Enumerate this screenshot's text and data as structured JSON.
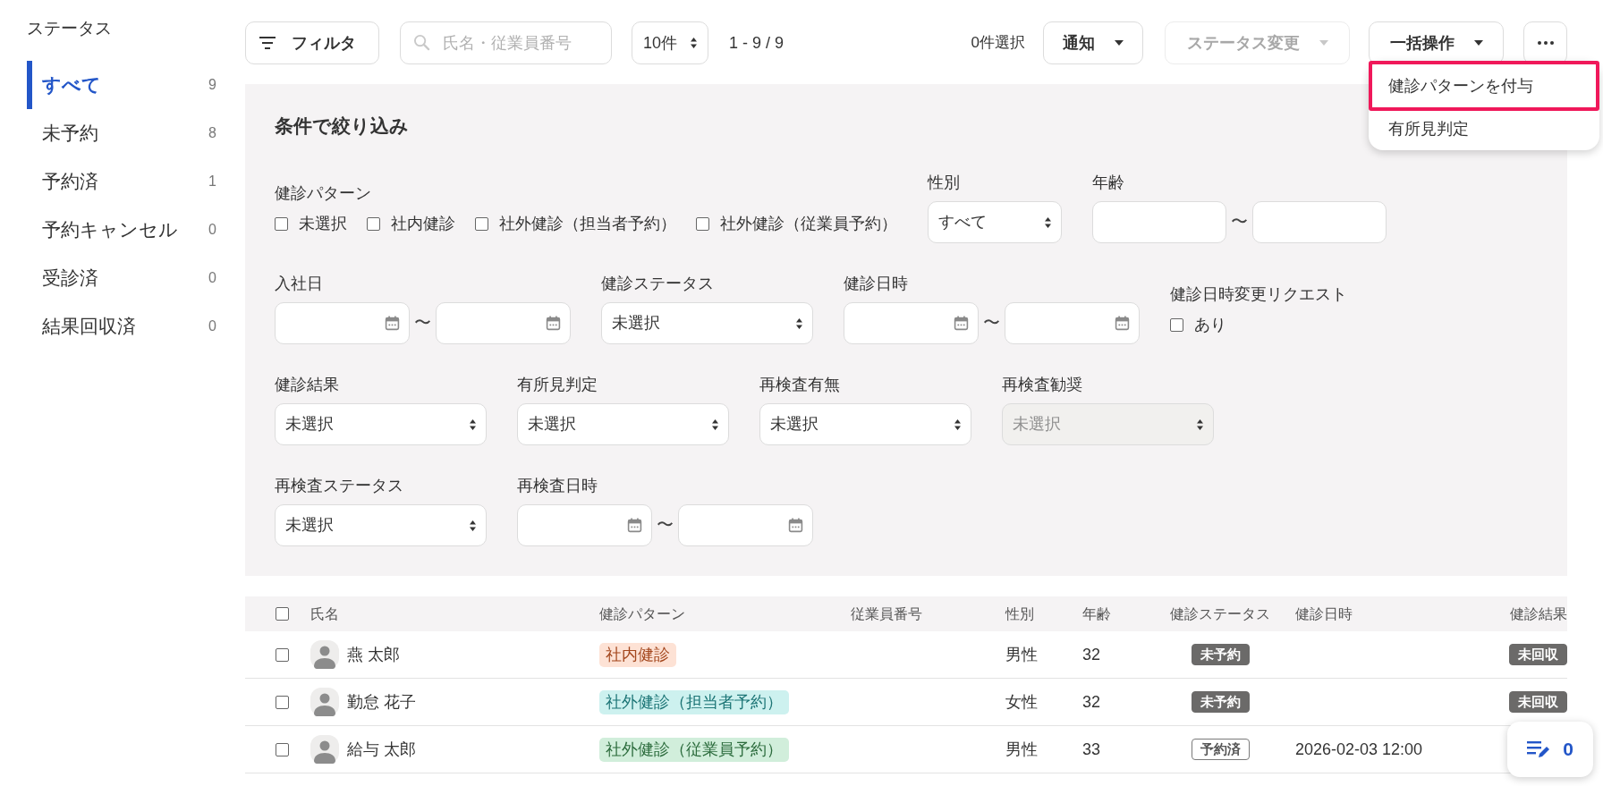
{
  "sidebar": {
    "title": "ステータス",
    "items": [
      {
        "label": "すべて",
        "count": "9",
        "selected": true
      },
      {
        "label": "未予約",
        "count": "8",
        "selected": false
      },
      {
        "label": "予約済",
        "count": "1",
        "selected": false
      },
      {
        "label": "予約キャンセル",
        "count": "0",
        "selected": false
      },
      {
        "label": "受診済",
        "count": "0",
        "selected": false
      },
      {
        "label": "結果回収済",
        "count": "0",
        "selected": false
      }
    ]
  },
  "toolbar": {
    "filter_button": "フィルタ",
    "search": {
      "placeholder": "氏名・従業員番号"
    },
    "page_size": "10件",
    "range": "1 - 9 / 9",
    "selection_count": "0件選択",
    "actions": [
      {
        "label": "通知",
        "disabled": false
      },
      {
        "label": "ステータス変更",
        "disabled": true
      },
      {
        "label": "一括操作",
        "disabled": false,
        "expanded": true,
        "menu": [
          {
            "label": "健診パターンを付与",
            "highlighted": true
          },
          {
            "label": "有所見判定",
            "highlighted": false
          }
        ]
      }
    ]
  },
  "filter_panel": {
    "title": "条件で絞り込み",
    "rows": [
      [
        {
          "kind": "checkboxes",
          "label": "健診パターン",
          "options": [
            {
              "label": "未選択",
              "checked": false
            },
            {
              "label": "社内健診",
              "checked": false
            },
            {
              "label": "社外健診（担当者予約）",
              "checked": false
            },
            {
              "label": "社外健診（従業員予約）",
              "checked": false
            }
          ]
        },
        {
          "kind": "select",
          "label": "性別",
          "value": "すべて",
          "disabled": false
        },
        {
          "kind": "number_range",
          "label": "年齢",
          "separator": "〜"
        }
      ],
      [
        {
          "kind": "date_range",
          "label": "入社日",
          "separator": "〜"
        },
        {
          "kind": "select",
          "label": "健診ステータス",
          "value": "未選択",
          "disabled": false
        },
        {
          "kind": "date_range",
          "label": "健診日時",
          "separator": "〜"
        },
        {
          "kind": "checkboxes",
          "label": "健診日時変更リクエスト",
          "options": [
            {
              "label": "あり",
              "checked": false
            }
          ]
        }
      ],
      [
        {
          "kind": "select",
          "label": "健診結果",
          "value": "未選択",
          "disabled": false
        },
        {
          "kind": "select",
          "label": "有所見判定",
          "value": "未選択",
          "disabled": false
        },
        {
          "kind": "select",
          "label": "再検査有無",
          "value": "未選択",
          "disabled": false
        },
        {
          "kind": "select",
          "label": "再検査勧奨",
          "value": "未選択",
          "disabled": true
        }
      ],
      [
        {
          "kind": "select",
          "label": "再検査ステータス",
          "value": "未選択",
          "disabled": false
        },
        {
          "kind": "date_range",
          "label": "再検査日時",
          "separator": "〜"
        }
      ]
    ]
  },
  "table": {
    "select_all": {
      "checked": false
    },
    "columns": [
      "氏名",
      "健診パターン",
      "従業員番号",
      "性別",
      "年齢",
      "健診ステータス",
      "健診日時",
      "健診結果"
    ],
    "rows": [
      {
        "checked": false,
        "name": "燕 太郎",
        "pattern": {
          "label": "社内健診",
          "kind": "internal"
        },
        "gender": "男性",
        "age": "32",
        "status": {
          "label": "未予約",
          "kind": "filled"
        },
        "result": {
          "label": "未回収",
          "kind": "filled"
        }
      },
      {
        "checked": false,
        "name": "勤怠 花子",
        "pattern": {
          "label": "社外健診（担当者予約）",
          "kind": "external_staff"
        },
        "gender": "女性",
        "age": "32",
        "status": {
          "label": "未予約",
          "kind": "filled"
        },
        "result": {
          "label": "未回収",
          "kind": "filled"
        }
      },
      {
        "checked": false,
        "name": "給与 太郎",
        "pattern": {
          "label": "社外健診（従業員予約）",
          "kind": "external_employee"
        },
        "gender": "男性",
        "age": "33",
        "status": {
          "label": "予約済",
          "kind": "outline"
        },
        "datetime": "2026-02-03 12:00"
      }
    ]
  },
  "floating_button": {
    "count": "0"
  }
}
